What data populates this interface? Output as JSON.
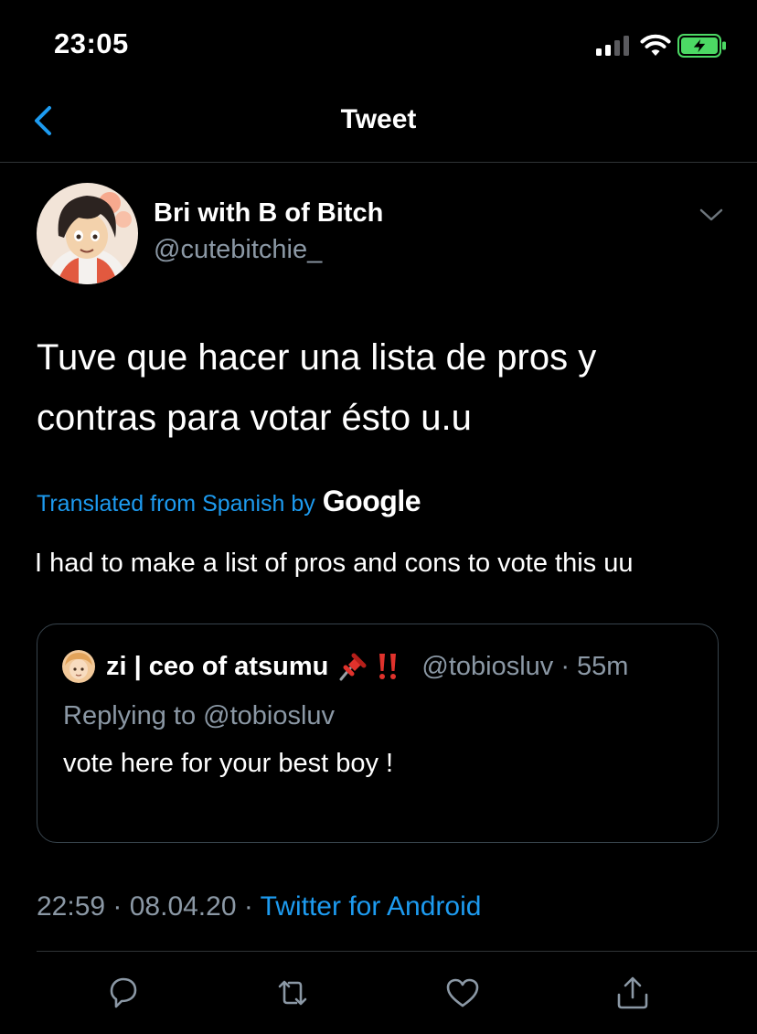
{
  "status_bar": {
    "time": "23:05",
    "icons": [
      "signal-icon",
      "wifi-icon",
      "battery-charging-icon"
    ]
  },
  "header": {
    "title": "Tweet",
    "back_icon": "chevron-left-icon"
  },
  "tweet": {
    "author_name": "Bri with B of Bitch",
    "author_handle": "@cutebitchie_",
    "text_line1": "Tuve que hacer una lista de pros y",
    "text_line2": "contras para votar ésto u.u",
    "translated_label": "Translated from Spanish by",
    "translator": "Google",
    "translated_text": "I had to make a list of pros and cons to vote this uu",
    "timestamp": "22:59 · 08.04.20 · ",
    "source": "Twitter for Android"
  },
  "quote": {
    "name": "zi | ceo of atsumu",
    "handle": "@tobiosluv · 55m",
    "replying": "Replying to @tobiosluv",
    "text": "vote here for your best boy !",
    "emoji_icons": [
      "pushpin-icon",
      "double-exclamation-icon"
    ]
  },
  "actions": [
    "reply-icon",
    "retweet-icon",
    "like-icon",
    "share-icon"
  ],
  "colors": {
    "background": "#000000",
    "accent": "#1d9bf0",
    "secondary_text": "#8b98a5",
    "battery": "#4cd964"
  }
}
